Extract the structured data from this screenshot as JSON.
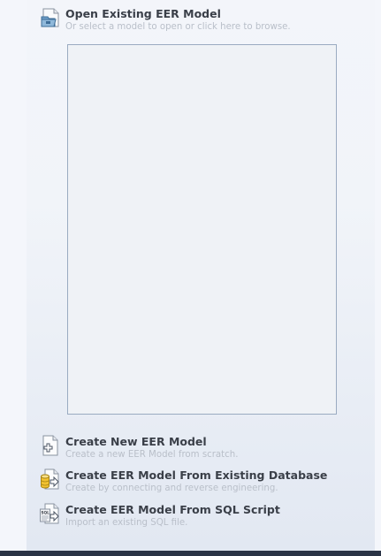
{
  "open_model": {
    "title": "Open Existing EER Model",
    "subtitle": "Or select a model to open or click here to browse.",
    "icon": "folder-open-icon"
  },
  "actions": [
    {
      "title": "Create New EER Model",
      "subtitle": "Create a new EER Model from scratch.",
      "icon": "new-document-icon"
    },
    {
      "title": "Create EER Model From Existing Database",
      "subtitle": "Create by connecting and reverse engineering.",
      "icon": "database-import-icon"
    },
    {
      "title": "Create EER Model From SQL Script",
      "subtitle": "Import an existing SQL file.",
      "icon": "sql-import-icon"
    }
  ],
  "sql_icon_text": "SQL",
  "colors": {
    "panel_background": "#f1f4f9",
    "title_text": "#3a3f48",
    "subtitle_text": "#b9bfc9",
    "list_border": "#9aabc1",
    "bottom_bar": "#2a3345"
  }
}
